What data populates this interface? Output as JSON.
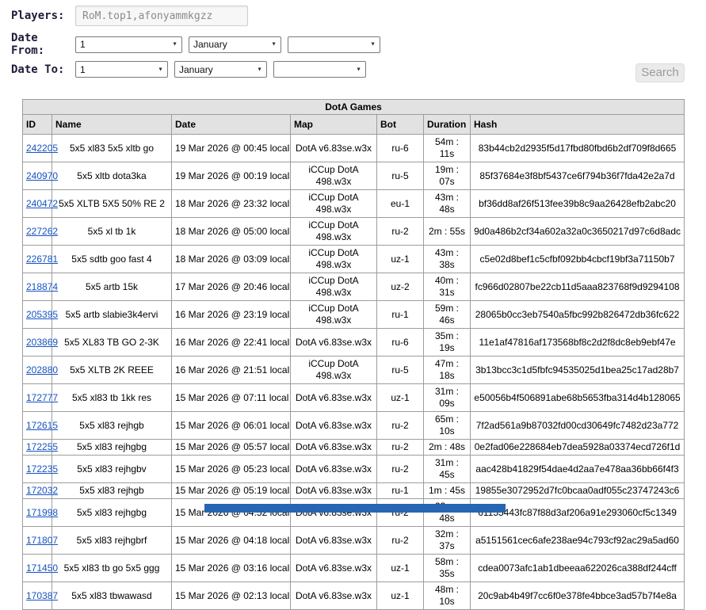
{
  "form": {
    "players_label": "Players:",
    "players_value": "RoM.top1,afonyammkgzz",
    "date_from_label": "Date From:",
    "date_to_label": "Date To:",
    "date_from": {
      "day": "1",
      "month": "January",
      "year": ""
    },
    "date_to": {
      "day": "1",
      "month": "January",
      "year": ""
    },
    "search_label": "Search"
  },
  "table": {
    "title": "DotA Games",
    "columns": [
      "ID",
      "Name",
      "Date",
      "Map",
      "Bot",
      "Duration",
      "Hash"
    ],
    "rows": [
      {
        "id": "242205",
        "name": "5x5 xl83 5x5 xltb go",
        "date": "19 Mar 2026 @ 00:45 local",
        "map": "DotA v6.83se.w3x",
        "bot": "ru-6",
        "duration": "54m : 11s",
        "hash": "83b44cb2d2935f5d17fbd80fbd6b2df709f8d665"
      },
      {
        "id": "240970",
        "name": "5x5 xltb dota3ka",
        "date": "19 Mar 2026 @ 00:19 local",
        "map": "iCCup DotA 498.w3x",
        "bot": "ru-5",
        "duration": "19m : 07s",
        "hash": "85f37684e3f8bf5437ce6f794b36f7fda42e2a7d"
      },
      {
        "id": "240472",
        "name": "5x5 XLTB 5X5 50% RE 2",
        "date": "18 Mar 2026 @ 23:32 local",
        "map": "iCCup DotA 498.w3x",
        "bot": "eu-1",
        "duration": "43m : 48s",
        "hash": "bf36dd8af26f513fee39b8c9aa26428efb2abc20"
      },
      {
        "id": "227262",
        "name": "5x5 xl tb 1k",
        "date": "18 Mar 2026 @ 05:00 local",
        "map": "iCCup DotA 498.w3x",
        "bot": "ru-2",
        "duration": "2m : 55s",
        "hash": "9d0a486b2cf34a602a32a0c3650217d97c6d8adc"
      },
      {
        "id": "226781",
        "name": "5x5 sdtb goo fast 4",
        "date": "18 Mar 2026 @ 03:09 local",
        "map": "iCCup DotA 498.w3x",
        "bot": "uz-1",
        "duration": "43m : 38s",
        "hash": "c5e02d8bef1c5cfbf092bb4cbcf19bf3a71150b7"
      },
      {
        "id": "218874",
        "name": "5x5 artb 15k",
        "date": "17 Mar 2026 @ 20:46 local",
        "map": "iCCup DotA 498.w3x",
        "bot": "uz-2",
        "duration": "40m : 31s",
        "hash": "fc966d02807be22cb11d5aaa823768f9d9294108"
      },
      {
        "id": "205395",
        "name": "5x5 artb slabie3k4ervi",
        "date": "16 Mar 2026 @ 23:19 local",
        "map": "iCCup DotA 498.w3x",
        "bot": "ru-1",
        "duration": "59m : 46s",
        "hash": "28065b0cc3eb7540a5fbc992b826472db36fc622"
      },
      {
        "id": "203869",
        "name": "5x5 XL83 TB GO 2-3K",
        "date": "16 Mar 2026 @ 22:41 local",
        "map": "DotA v6.83se.w3x",
        "bot": "ru-6",
        "duration": "35m : 19s",
        "hash": "11e1af47816af173568bf8c2d2f8dc8eb9ebf47e"
      },
      {
        "id": "202880",
        "name": "5x5 XLTB 2K REEE",
        "date": "16 Mar 2026 @ 21:51 local",
        "map": "iCCup DotA 498.w3x",
        "bot": "ru-5",
        "duration": "47m : 18s",
        "hash": "3b13bcc3c1d5fbfc94535025d1bea25c17ad28b7"
      },
      {
        "id": "172777",
        "name": "5x5 xl83 tb 1kk res",
        "date": "15 Mar 2026 @ 07:11 local",
        "map": "DotA v6.83se.w3x",
        "bot": "uz-1",
        "duration": "31m : 09s",
        "hash": "e50056b4f506891abe68b5653fba314d4b128065"
      },
      {
        "id": "172615",
        "name": "5x5 xl83 rejhgb",
        "date": "15 Mar 2026 @ 06:01 local",
        "map": "DotA v6.83se.w3x",
        "bot": "ru-2",
        "duration": "65m : 10s",
        "hash": "7f2ad561a9b87032fd00cd30649fc7482d23a772"
      },
      {
        "id": "172255",
        "name": "5x5 xl83 rejhgbg",
        "date": "15 Mar 2026 @ 05:57 local",
        "map": "DotA v6.83se.w3x",
        "bot": "ru-2",
        "duration": "2m : 48s",
        "hash": "0e2fad06e228684eb7dea5928a03374ecd726f1d"
      },
      {
        "id": "172235",
        "name": "5x5 xl83 rejhgbv",
        "date": "15 Mar 2026 @ 05:23 local",
        "map": "DotA v6.83se.w3x",
        "bot": "ru-2",
        "duration": "31m : 45s",
        "hash": "aac428b41829f54dae4d2aa7e478aa36bb66f4f3"
      },
      {
        "id": "172032",
        "name": "5x5 xl83 rejhgb",
        "date": "15 Mar 2026 @ 05:19 local",
        "map": "DotA v6.83se.w3x",
        "bot": "ru-1",
        "duration": "1m : 45s",
        "hash": "19855e3072952d7fc0bcaa0adf055c23747243c6"
      },
      {
        "id": "171998",
        "name": "5x5 xl83 rejhgbg",
        "date": "15 Mar 2026 @ 04:52 local",
        "map": "DotA v6.83se.w3x",
        "bot": "ru-2",
        "duration": "23m : 48s",
        "hash": "61155443fc87f88d3af206a91e293060cf5c1349"
      },
      {
        "id": "171807",
        "name": "5x5 xl83 rejhgbrf",
        "date": "15 Mar 2026 @ 04:18 local",
        "map": "DotA v6.83se.w3x",
        "bot": "ru-2",
        "duration": "32m : 37s",
        "hash": "a5151561cec6afe238ae94c793cf92ac29a5ad60"
      },
      {
        "id": "171450",
        "name": "5x5 xl83 tb go 5x5 ggg",
        "date": "15 Mar 2026 @ 03:16 local",
        "map": "DotA v6.83se.w3x",
        "bot": "uz-1",
        "duration": "58m : 35s",
        "hash": "cdea0073afc1ab1dbeeaa622026ca388df244cff"
      },
      {
        "id": "170387",
        "name": "5x5 xl83 tbwawasd",
        "date": "15 Mar 2026 @ 02:13 local",
        "map": "DotA v6.83se.w3x",
        "bot": "uz-1",
        "duration": "48m : 10s",
        "hash": "20c9ab4b49f7cc6f0e378fe4bbce3ad57b7f4e8a"
      }
    ]
  },
  "colors": {
    "link": "#1652c2",
    "header-bg": "#e2e2e2",
    "border-color": "#9d9d9d",
    "footer-bar": "#2766b0"
  }
}
